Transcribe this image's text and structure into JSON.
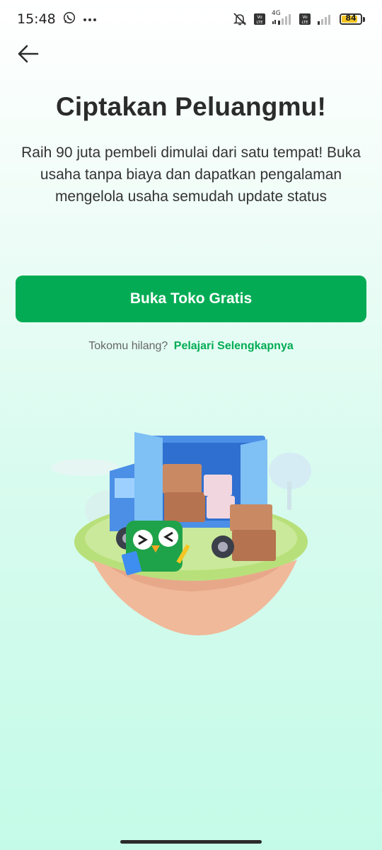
{
  "status_bar": {
    "time": "15:48",
    "network": "4G",
    "volte_1": "Vo LTE",
    "volte_2": "Vo LTE",
    "battery": "84",
    "battery_level": 0.84,
    "battery_color": "#f5c623",
    "icons": [
      "whatsapp-icon",
      "more-dots-icon",
      "mute-icon",
      "signal-icon",
      "battery-icon"
    ]
  },
  "header": {
    "back_icon": "arrow-left-icon"
  },
  "main": {
    "title": "Ciptakan Peluangmu!",
    "description": "Raih 90 juta pembeli dimulai dari satu tempat! Buka usaha tanpa biaya dan dapatkan pengalaman mengelola usaha semudah update status",
    "cta_label": "Buka Toko Gratis",
    "help_text": "Tokomu hilang?",
    "help_link": "Pelajari Selengkapnya"
  },
  "colors": {
    "accent": "#03ac54",
    "title": "#2b2b2b",
    "background_bottom": "#c4fbe8"
  }
}
